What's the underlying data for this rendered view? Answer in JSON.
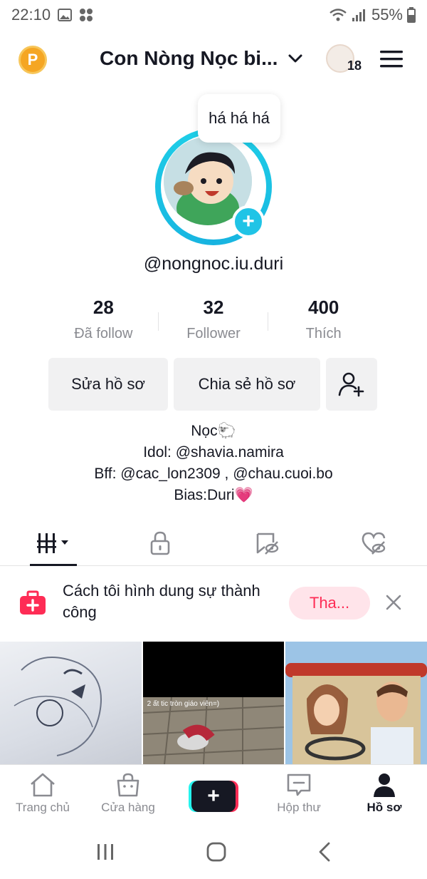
{
  "status_bar": {
    "time": "22:10",
    "battery": "55%"
  },
  "header": {
    "account_name": "Con Nòng Nọc bi...",
    "notification_count": "18"
  },
  "profile": {
    "bubble_text": "há há há",
    "username": "@nongnoc.iu.duri",
    "stats": [
      {
        "value": "28",
        "label": "Đã follow"
      },
      {
        "value": "32",
        "label": "Follower"
      },
      {
        "value": "400",
        "label": "Thích"
      }
    ],
    "buttons": {
      "edit": "Sửa hồ sơ",
      "share": "Chia sẻ hồ sơ"
    },
    "bio": [
      "Nọc🐑",
      "Idol: @shavia.namira",
      "Bff: @cac_lon2309 , @chau.cuoi.bo",
      "Bias:Duri💗"
    ]
  },
  "tabs": [
    "videos-grid",
    "private",
    "reposts",
    "liked"
  ],
  "promo": {
    "text": "Cách tôi hình dung sự thành công",
    "button": "Tha..."
  },
  "videos": [
    {
      "caption": ""
    },
    {
      "caption": "2 ất tic tròn giáo viên=)"
    },
    {
      "caption": ""
    }
  ],
  "bottom_nav": [
    {
      "label": "Trang chủ",
      "icon": "home-icon"
    },
    {
      "label": "Cửa hàng",
      "icon": "shop-icon"
    },
    {
      "label": "",
      "icon": "plus-icon"
    },
    {
      "label": "Hộp thư",
      "icon": "inbox-icon"
    },
    {
      "label": "Hồ sơ",
      "icon": "profile-icon"
    }
  ],
  "colors": {
    "accent": "#fe2c55",
    "ring": "#1fd1e8",
    "text": "#161823",
    "muted": "#8a8b91"
  }
}
